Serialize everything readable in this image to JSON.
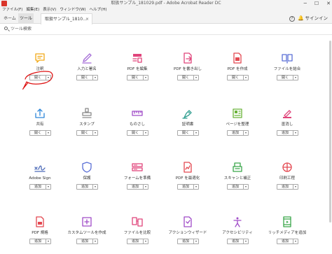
{
  "window": {
    "title": "取扱サンプル_181029.pdf - Adobe Acrobat Reader DC",
    "min": "─",
    "max": "☐",
    "close": "✕"
  },
  "menu": [
    "ファイル(F)",
    "編集(E)",
    "表示(V)",
    "ウィンドウ(W)",
    "ヘルプ(H)"
  ],
  "tabs": {
    "home": "ホーム",
    "tools": "ツール",
    "document": "取扱サンプル_1810...",
    "document_close": "×"
  },
  "header": {
    "help": "?",
    "bell": "🔔",
    "signin": "サインイン"
  },
  "search": {
    "placeholder": "ツール検索"
  },
  "tools": [
    {
      "label": "注釈",
      "action": "開く",
      "icon": "comment-icon",
      "color": "#f2a917"
    },
    {
      "label": "入力と署名",
      "action": "開く",
      "icon": "fill-sign-icon",
      "color": "#a36bd6"
    },
    {
      "label": "PDF を編集",
      "action": "開く",
      "icon": "edit-pdf-icon",
      "color": "#e0457b"
    },
    {
      "label": "PDF を書き出し",
      "action": "開く",
      "icon": "export-pdf-icon",
      "color": "#e0457b"
    },
    {
      "label": "PDF を作成",
      "action": "開く",
      "icon": "create-pdf-icon",
      "color": "#e34850"
    },
    {
      "label": "ファイルを結合",
      "action": "開く",
      "icon": "combine-files-icon",
      "color": "#5a6fd6"
    },
    {
      "label": "共有",
      "action": "開く",
      "icon": "share-icon",
      "color": "#2d86d9"
    },
    {
      "label": "スタンプ",
      "action": "開く",
      "icon": "stamp-icon",
      "color": "#8a8a8a"
    },
    {
      "label": "ものさし",
      "action": "開く",
      "icon": "measure-icon",
      "color": "#a04cc8"
    },
    {
      "label": "証明書",
      "action": "開く",
      "icon": "certificate-icon",
      "color": "#2f9e8f"
    },
    {
      "label": "ページを整理",
      "action": "追加",
      "icon": "organize-pages-icon",
      "color": "#6bb33a"
    },
    {
      "label": "墨消し",
      "action": "追加",
      "icon": "redact-icon",
      "color": "#e0457b"
    },
    {
      "label": "Adobe Sign",
      "action": "追加",
      "icon": "adobe-sign-icon",
      "color": "#4c6ab8"
    },
    {
      "label": "保護",
      "action": "追加",
      "icon": "protect-icon",
      "color": "#5a6fd6"
    },
    {
      "label": "フォームを準備",
      "action": "追加",
      "icon": "prepare-form-icon",
      "color": "#e0457b"
    },
    {
      "label": "PDF を最適化",
      "action": "追加",
      "icon": "optimize-pdf-icon",
      "color": "#e34850"
    },
    {
      "label": "スキャンと補正",
      "action": "追加",
      "icon": "scan-icon",
      "color": "#3aa64a"
    },
    {
      "label": "印刷工程",
      "action": "追加",
      "icon": "print-production-icon",
      "color": "#e34850"
    },
    {
      "label": "PDF 規格",
      "action": "追加",
      "icon": "pdf-standards-icon",
      "color": "#e34850"
    },
    {
      "label": "カスタムツールを作成",
      "action": "追加",
      "icon": "custom-tool-icon",
      "color": "#a04cc8"
    },
    {
      "label": "ファイルを比較",
      "action": "追加",
      "icon": "compare-files-icon",
      "color": "#e0457b"
    },
    {
      "label": "アクションウィザード",
      "action": "追加",
      "icon": "action-wizard-icon",
      "color": "#a04cc8"
    },
    {
      "label": "アクセシビリティ",
      "action": "追加",
      "icon": "accessibility-icon",
      "color": "#a04cc8"
    },
    {
      "label": "リッチメディアを追加",
      "action": "追加",
      "icon": "rich-media-icon",
      "color": "#3aa64a"
    }
  ]
}
